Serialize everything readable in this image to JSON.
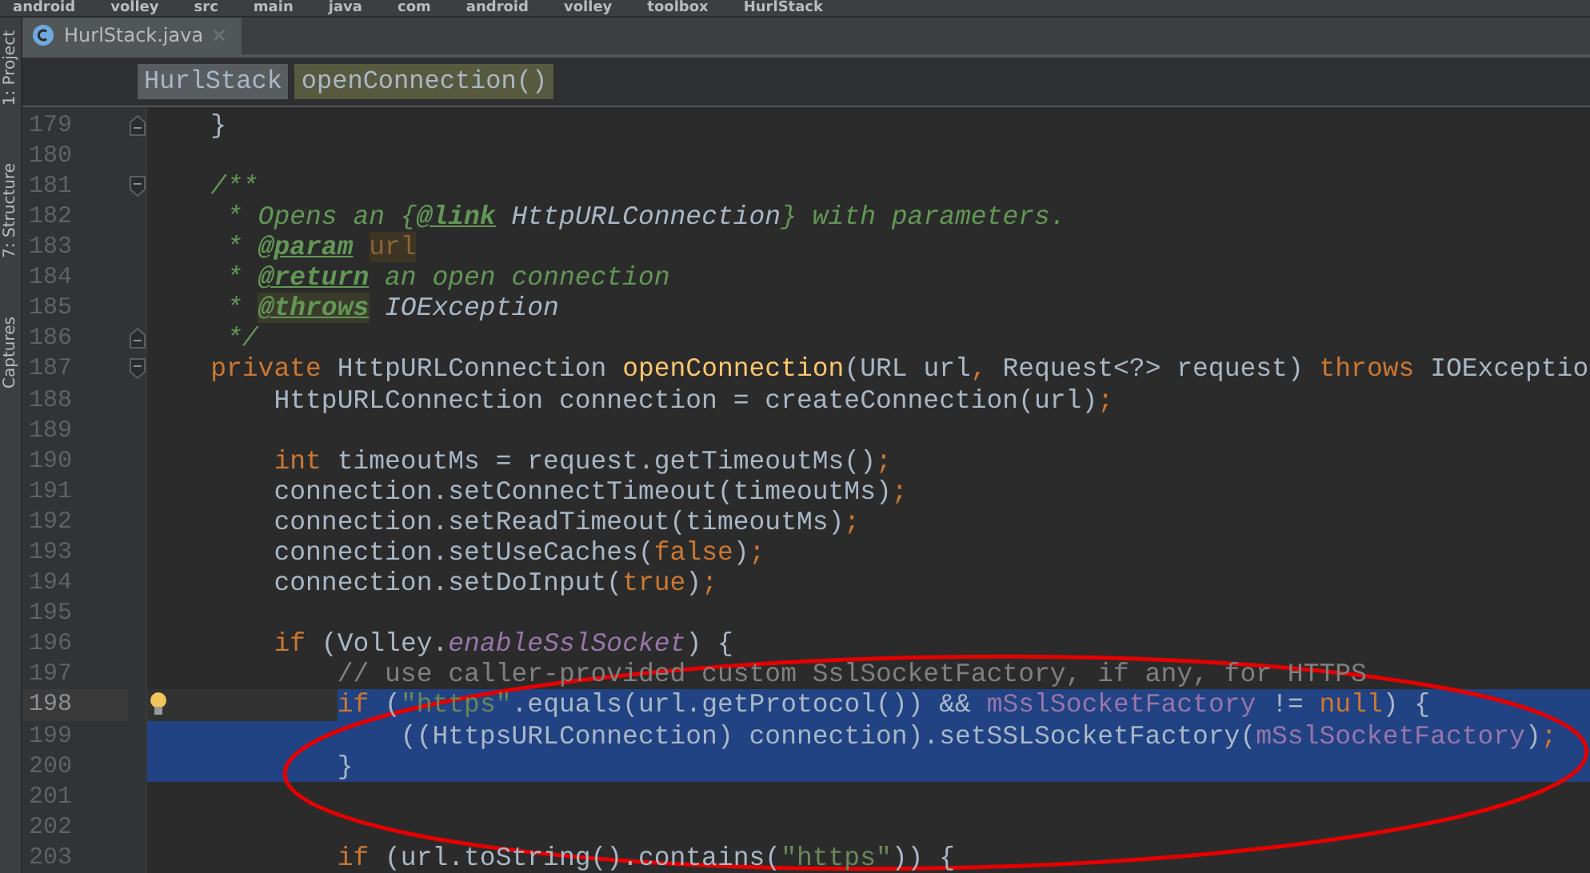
{
  "breadcrumbs": [
    "android",
    "volley",
    "src",
    "main",
    "java",
    "com",
    "android",
    "volley",
    "toolbox",
    "HurlStack"
  ],
  "side_tools": [
    {
      "label": "1: Project"
    },
    {
      "label": "7: Structure"
    },
    {
      "label": "Captures"
    }
  ],
  "tabs": [
    {
      "label": "HurlStack.java",
      "selected": true
    }
  ],
  "editor_breadcrumbs": [
    {
      "label": "HurlStack",
      "kind": "class"
    },
    {
      "label": "openConnection()",
      "kind": "method"
    }
  ],
  "lines": [
    {
      "number": "179",
      "fold_end": true,
      "tokens": [
        {
          "text": "    }",
          "kind": "plain"
        }
      ]
    },
    {
      "number": "180"
    },
    {
      "number": "181",
      "fold_start": true,
      "tokens": [
        {
          "text": "    /**",
          "kind": "doc"
        }
      ]
    },
    {
      "number": "182",
      "tokens": [
        {
          "text": "     * Opens an {",
          "kind": "doc"
        },
        {
          "text": "@link",
          "kind": "doctag"
        },
        {
          "text": " HttpURLConnection",
          "kind": "docref"
        },
        {
          "text": "} with parameters.",
          "kind": "doc"
        }
      ]
    },
    {
      "number": "183",
      "tokens": [
        {
          "text": "     * ",
          "kind": "doc"
        },
        {
          "text": "@param",
          "kind": "doctag"
        },
        {
          "text": "url",
          "kind": "docparam"
        }
      ]
    },
    {
      "number": "184",
      "tokens": [
        {
          "text": "     * ",
          "kind": "doc"
        },
        {
          "text": "@return",
          "kind": "doctag"
        },
        {
          "text": " an open connection",
          "kind": "doc"
        }
      ]
    },
    {
      "number": "185",
      "tokens": [
        {
          "text": "     * ",
          "kind": "doc"
        },
        {
          "text": "@throws",
          "kind": "doctag_marked"
        },
        {
          "text": " IOException",
          "kind": "docref"
        }
      ]
    },
    {
      "number": "186",
      "fold_end": true,
      "tokens": [
        {
          "text": "     */",
          "kind": "doc"
        }
      ]
    },
    {
      "number": "187",
      "fold_start": true,
      "tokens": [
        {
          "text": "    private",
          "kind": "keyword"
        },
        {
          "text": " HttpURLConnection ",
          "kind": "plain"
        },
        {
          "text": "openConnection",
          "kind": "decl"
        },
        {
          "text": "(URL url",
          "kind": "plain"
        },
        {
          "text": ",",
          "kind": "keyword"
        },
        {
          "text": " Request<?> request) ",
          "kind": "plain"
        },
        {
          "text": "throws",
          "kind": "keyword"
        },
        {
          "text": " IOExceptio",
          "kind": "plain"
        }
      ]
    },
    {
      "number": "188",
      "tokens": [
        {
          "text": "        HttpURLConnection connection = createConnection(url)",
          "kind": "plain"
        },
        {
          "text": ";",
          "kind": "keyword"
        }
      ]
    },
    {
      "number": "189"
    },
    {
      "number": "190",
      "tokens": [
        {
          "text": "        int",
          "kind": "keyword"
        },
        {
          "text": " timeoutMs = request.getTimeoutMs()",
          "kind": "plain"
        },
        {
          "text": ";",
          "kind": "keyword"
        }
      ]
    },
    {
      "number": "191",
      "tokens": [
        {
          "text": "        connection.setConnectTimeout(timeoutMs)",
          "kind": "plain"
        },
        {
          "text": ";",
          "kind": "keyword"
        }
      ]
    },
    {
      "number": "192",
      "tokens": [
        {
          "text": "        connection.setReadTimeout(timeoutMs)",
          "kind": "plain"
        },
        {
          "text": ";",
          "kind": "keyword"
        }
      ]
    },
    {
      "number": "193",
      "tokens": [
        {
          "text": "        connection.setUseCaches(",
          "kind": "plain"
        },
        {
          "text": "false",
          "kind": "keyword"
        },
        {
          "text": ")",
          "kind": "plain"
        },
        {
          "text": ";",
          "kind": "keyword"
        }
      ]
    },
    {
      "number": "194",
      "tokens": [
        {
          "text": "        connection.setDoInput(",
          "kind": "plain"
        },
        {
          "text": "true",
          "kind": "keyword"
        },
        {
          "text": ")",
          "kind": "plain"
        },
        {
          "text": ";",
          "kind": "keyword"
        }
      ]
    },
    {
      "number": "195"
    },
    {
      "number": "196",
      "tokens": [
        {
          "text": "        if",
          "kind": "keyword"
        },
        {
          "text": " (Volley.",
          "kind": "plain"
        },
        {
          "text": "enableSslSocket",
          "kind": "static"
        },
        {
          "text": ") {",
          "kind": "plain"
        }
      ]
    },
    {
      "number": "197",
      "tokens": [
        {
          "text": "            // use caller-provided custom SslSocketFactory, if any, for HTTPS",
          "kind": "comment"
        }
      ]
    },
    {
      "number": "198",
      "selected": true,
      "selection_start": true,
      "current": true,
      "bulb": true,
      "tokens": [
        {
          "text": "            if",
          "kind": "keyword"
        },
        {
          "text": " (",
          "kind": "plain"
        },
        {
          "text": "\"https\"",
          "kind": "string"
        },
        {
          "text": ".equals(url.getProtocol()) && ",
          "kind": "plain"
        },
        {
          "text": "mSslSocketFactory",
          "kind": "member"
        },
        {
          "text": " != ",
          "kind": "plain"
        },
        {
          "text": "null",
          "kind": "keyword"
        },
        {
          "text": ") {",
          "kind": "plain"
        }
      ]
    },
    {
      "number": "199",
      "selected": true,
      "tokens": [
        {
          "text": "                ((HttpsURLConnection) connection).setSSLSocketFactory(",
          "kind": "plain"
        },
        {
          "text": "mSslSocketFactory",
          "kind": "member"
        },
        {
          "text": ")",
          "kind": "plain"
        },
        {
          "text": ";",
          "kind": "keyword"
        }
      ]
    },
    {
      "number": "200",
      "selected": true,
      "tokens": [
        {
          "text": "            }",
          "kind": "plain"
        }
      ]
    },
    {
      "number": "201"
    },
    {
      "number": "202"
    },
    {
      "number": "203",
      "tokens": [
        {
          "text": "            if",
          "kind": "keyword"
        },
        {
          "text": " (url.toString().contains(",
          "kind": "plain"
        },
        {
          "text": "\"https\"",
          "kind": "string"
        },
        {
          "text": ")) {",
          "kind": "plain"
        }
      ]
    }
  ],
  "markup": {
    "kind": "ellipse"
  }
}
